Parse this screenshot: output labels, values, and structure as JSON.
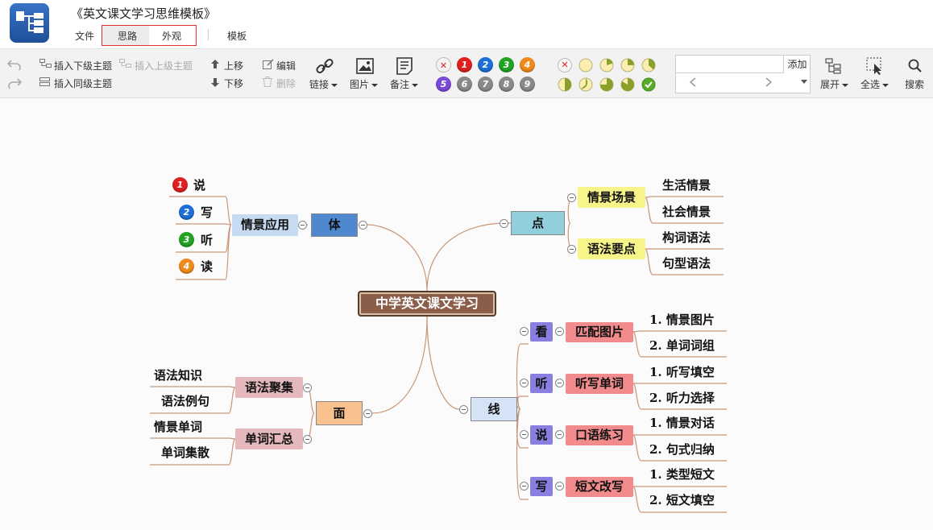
{
  "header": {
    "title": "《英文课文学习思维模板》",
    "menu": {
      "file": "文件",
      "thinking": "思路",
      "appearance": "外观",
      "template": "模板"
    }
  },
  "toolbar": {
    "insert_child": "插入下级主题",
    "insert_parent": "插入上级主题",
    "insert_sibling": "插入同级主题",
    "move_up": "上移",
    "move_down": "下移",
    "edit": "编辑",
    "delete": "删除",
    "link": "链接",
    "image": "图片",
    "note": "备注",
    "priorities": [
      "1",
      "2",
      "3",
      "4",
      "5",
      "6",
      "7",
      "8",
      "9"
    ],
    "add_label": "添加",
    "expand": "展开",
    "select_all": "全选",
    "search": "搜索",
    "colors": {
      "p1": "#e02020",
      "p2": "#1e6fd6",
      "p3": "#23a323",
      "p4": "#f08a1c",
      "p5": "#7a4bd8",
      "gray": "#8a8a8a"
    }
  },
  "mindmap": {
    "root": "中学英文课文学习",
    "branches": {
      "ti": {
        "label": "体",
        "child": "情景应用",
        "leaves": [
          {
            "n": "1",
            "text": "说"
          },
          {
            "n": "2",
            "text": "写"
          },
          {
            "n": "3",
            "text": "听"
          },
          {
            "n": "4",
            "text": "读"
          }
        ]
      },
      "dian": {
        "label": "点",
        "children": [
          {
            "label": "情景场景",
            "leaves": [
              "生活情景",
              "社会情景"
            ]
          },
          {
            "label": "语法要点",
            "leaves": [
              "构词语法",
              "句型语法"
            ]
          }
        ]
      },
      "mian": {
        "label": "面",
        "children": [
          {
            "label": "语法聚集",
            "leaves": [
              "语法知识",
              "语法例句"
            ]
          },
          {
            "label": "单词汇总",
            "leaves": [
              "情景单词",
              "单词集散"
            ]
          }
        ]
      },
      "xian": {
        "label": "线",
        "children": [
          {
            "label": "看",
            "sub": "匹配图片",
            "leaves": [
              "1. 情景图片",
              "2. 单词词组"
            ]
          },
          {
            "label": "听",
            "sub": "听写单词",
            "leaves": [
              "1. 听写填空",
              "2. 听力选择"
            ]
          },
          {
            "label": "说",
            "sub": "口语练习",
            "leaves": [
              "1. 情景对话",
              "2. 句式归纳"
            ]
          },
          {
            "label": "写",
            "sub": "短文改写",
            "leaves": [
              "1. 类型短文",
              "2. 短文填空"
            ]
          }
        ]
      }
    }
  }
}
